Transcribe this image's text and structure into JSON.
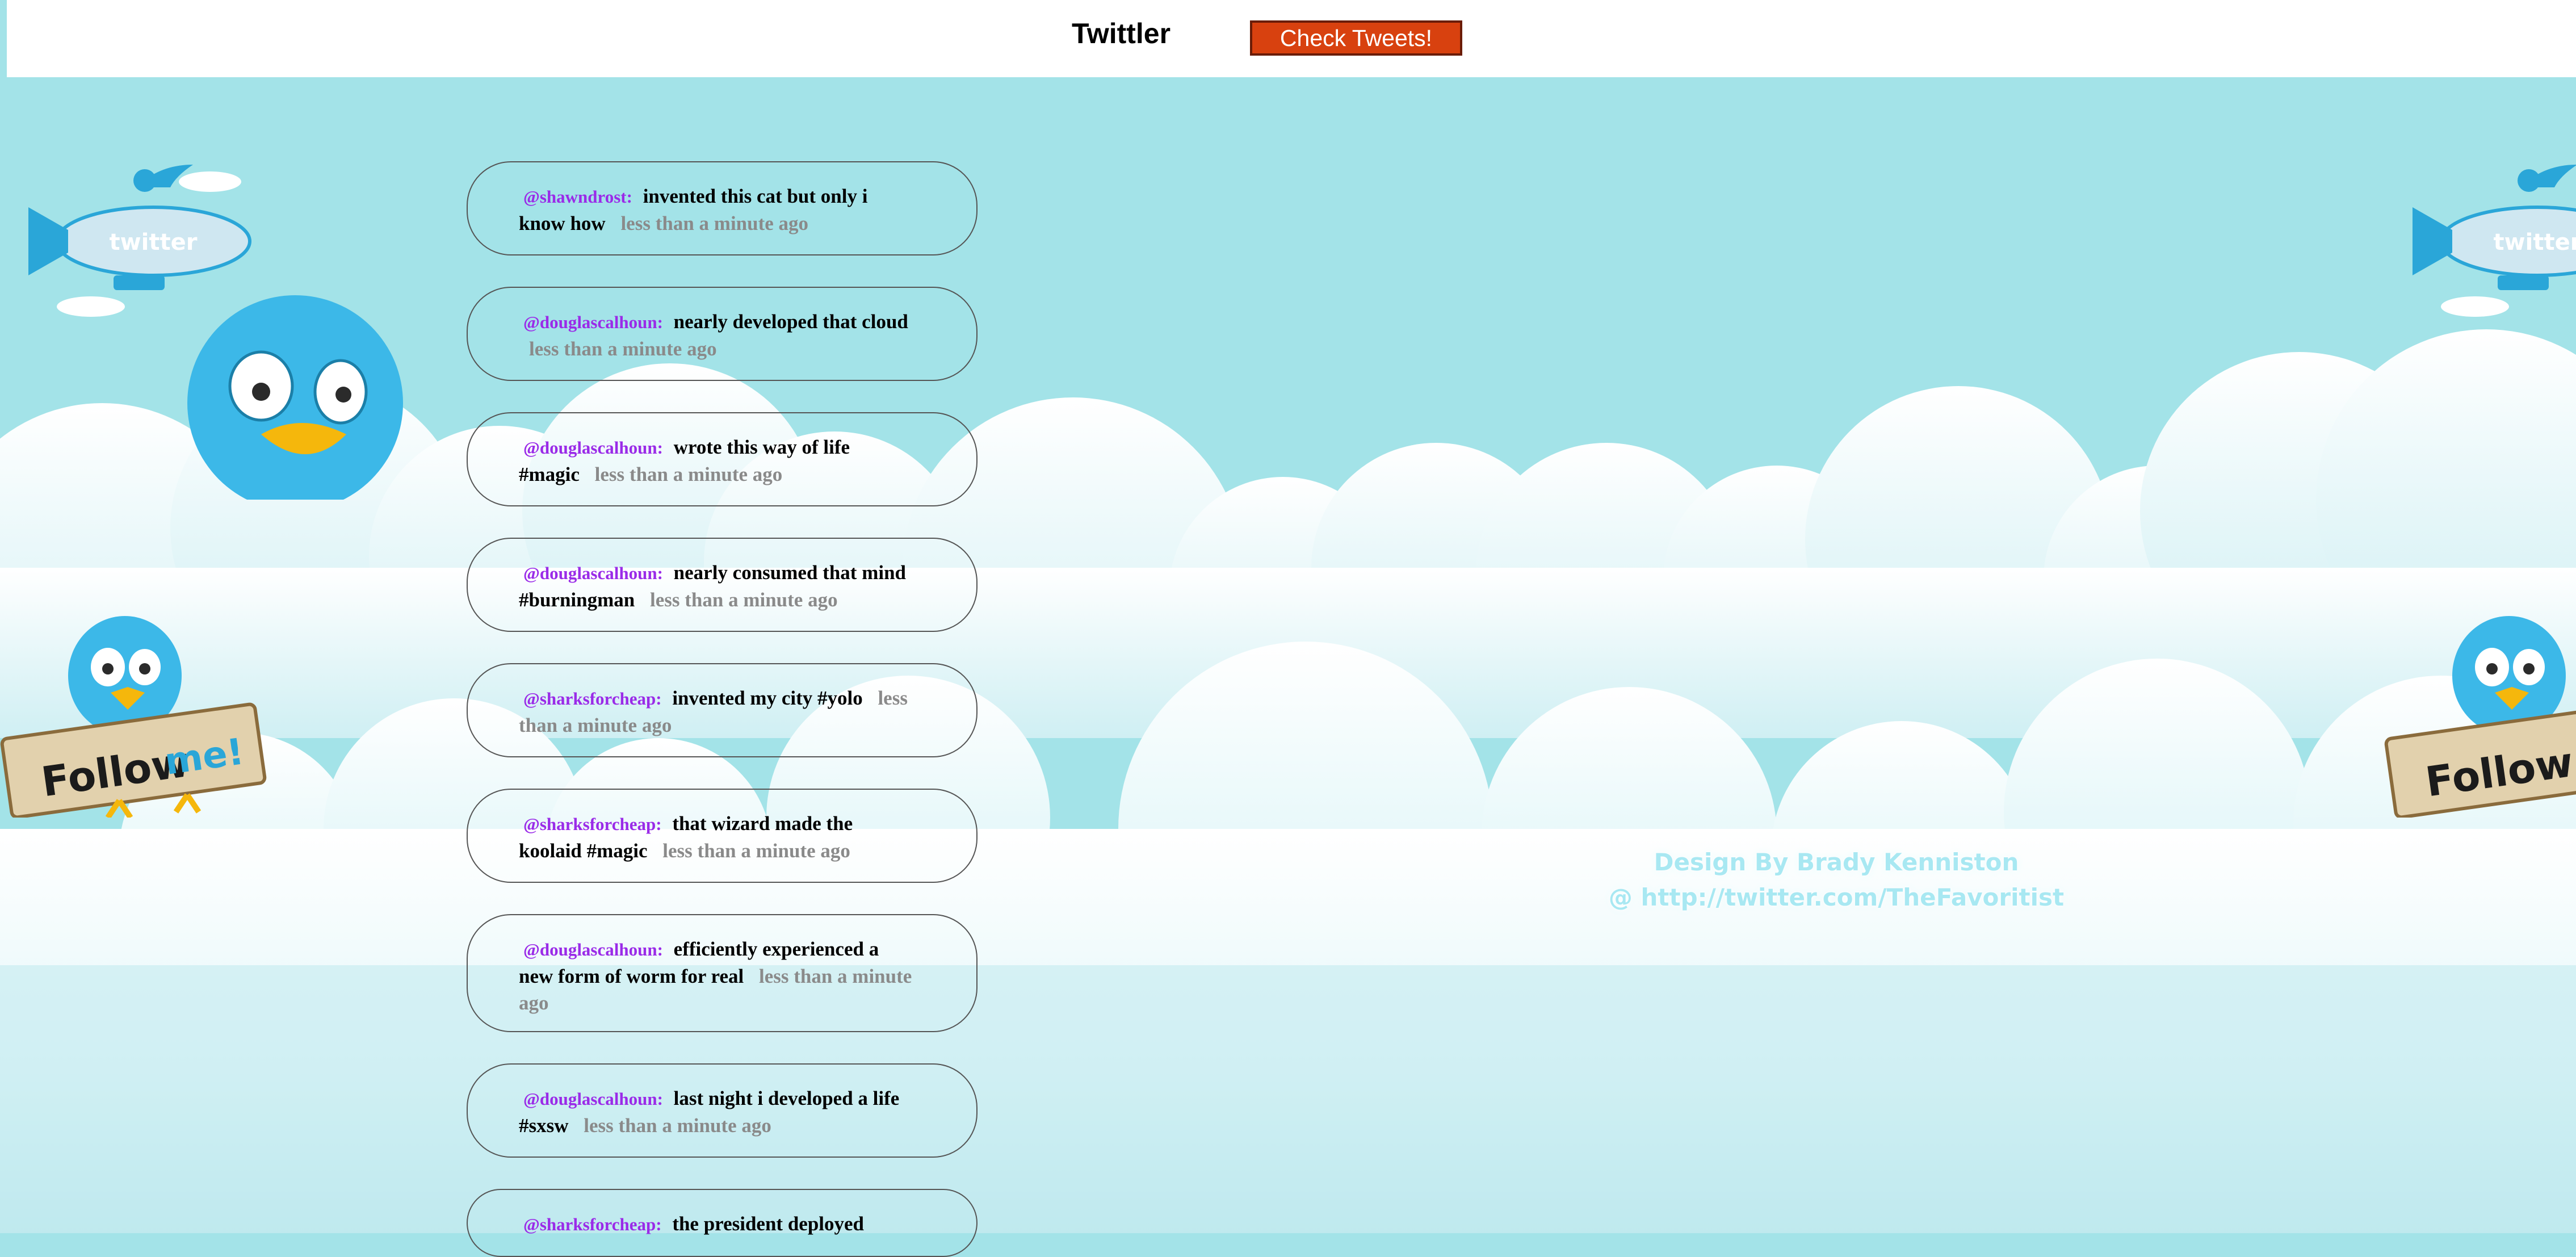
{
  "header": {
    "title": "Twittler",
    "check_button": "Check Tweets!"
  },
  "tweets": [
    {
      "user": "@shawndrost",
      "message": "invented this cat but only i know how",
      "time": "less than a minute ago"
    },
    {
      "user": "@douglascalhoun",
      "message": "nearly developed that cloud",
      "time": "less than a minute ago"
    },
    {
      "user": "@douglascalhoun",
      "message": "wrote this way of life #magic",
      "time": "less than a minute ago"
    },
    {
      "user": "@douglascalhoun",
      "message": "nearly consumed that mind #burningman",
      "time": "less than a minute ago"
    },
    {
      "user": "@sharksforcheap",
      "message": "invented my city #yolo",
      "time": "less than a minute ago"
    },
    {
      "user": "@sharksforcheap",
      "message": "that wizard made the koolaid #magic",
      "time": "less than a minute ago"
    },
    {
      "user": "@douglascalhoun",
      "message": "efficiently experienced a new form of worm for real",
      "time": "less than a minute ago"
    },
    {
      "user": "@douglascalhoun",
      "message": "last night i developed a life #sxsw",
      "time": "less than a minute ago"
    },
    {
      "user": "@sharksforcheap",
      "message": "the president deployed",
      "time": ""
    }
  ],
  "decor": {
    "blimp_label": "twitter",
    "sign_follow": "Follow",
    "sign_me": "me!"
  },
  "credit": {
    "line1": "Design By Brady Kenniston",
    "line2": "@ http://twitter.com/TheFavoritist"
  },
  "colors": {
    "background": "#a3e3e8",
    "cloud": "#f2fbfd",
    "handle": "#9a2be8",
    "timestamp": "#8a8a8a",
    "button": "#d8410f",
    "bird": "#3cb8e8"
  }
}
